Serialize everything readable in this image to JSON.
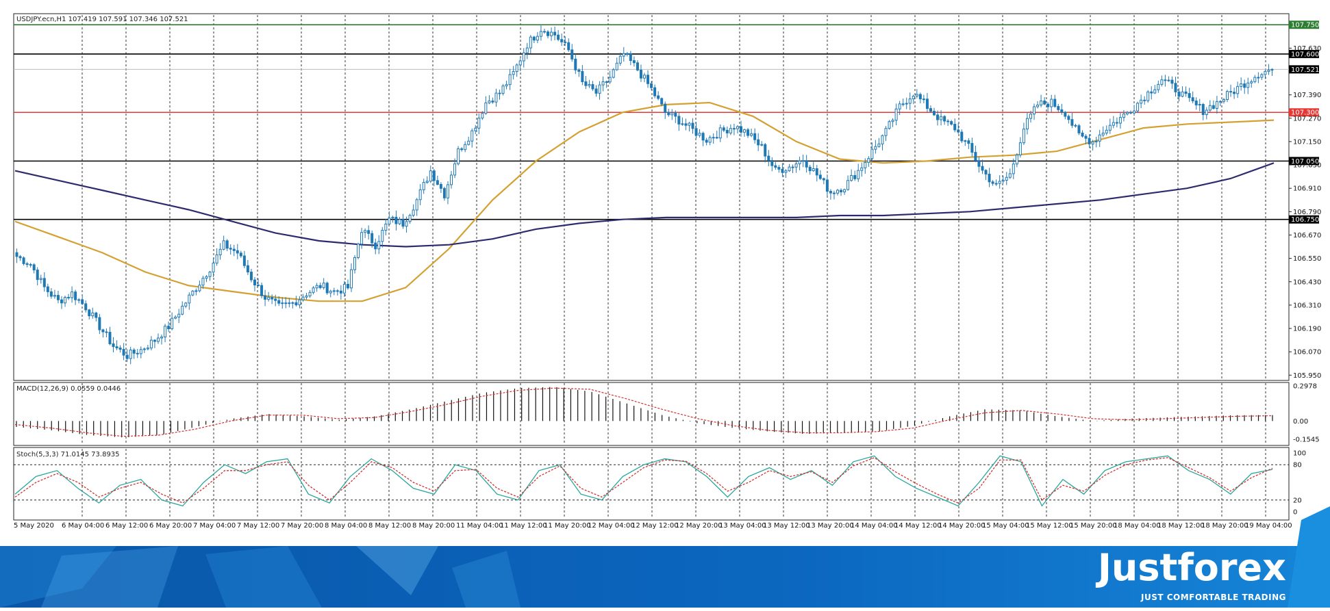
{
  "symbol_info": "USDJPY.ecn,H1  107.419 107.591 107.346 107.521",
  "brand": {
    "name": "Justforex",
    "tagline": "JUST COMFORTABLE TRADING"
  },
  "chart_data": [
    {
      "type": "candlestick",
      "pane": "price",
      "title": "USDJPY.ecn,H1  107.419 107.591 107.346 107.521",
      "symbol": "USDJPY.ecn",
      "timeframe": "H1",
      "last_ohlc": {
        "open": 107.419,
        "high": 107.591,
        "low": 107.346,
        "close": 107.521
      },
      "ylim": [
        105.93,
        107.8
      ],
      "y_ticks": [
        "107.630",
        "107.390",
        "107.270",
        "107.150",
        "107.030",
        "106.910",
        "106.790",
        "106.670",
        "106.550",
        "106.430",
        "106.310",
        "106.190",
        "106.070",
        "105.950"
      ],
      "x_ticks": [
        "5 May 2020",
        "6 May 04:00",
        "6 May 12:00",
        "6 May 20:00",
        "7 May 04:00",
        "7 May 12:00",
        "7 May 20:00",
        "8 May 04:00",
        "8 May 12:00",
        "8 May 20:00",
        "11 May 04:00",
        "11 May 12:00",
        "11 May 20:00",
        "12 May 04:00",
        "12 May 12:00",
        "12 May 20:00",
        "13 May 04:00",
        "13 May 12:00",
        "13 May 20:00",
        "14 May 04:00",
        "14 May 12:00",
        "14 May 20:00",
        "15 May 04:00",
        "15 May 12:00",
        "15 May 20:00",
        "18 May 04:00",
        "18 May 12:00",
        "18 May 20:00",
        "19 May 04:00"
      ],
      "grid": true,
      "close_path": [
        106.56,
        106.52,
        106.4,
        106.33,
        106.37,
        106.3,
        106.2,
        106.1,
        106.05,
        106.08,
        106.13,
        106.2,
        106.3,
        106.4,
        106.5,
        106.62,
        106.58,
        106.45,
        106.35,
        106.3,
        106.32,
        106.37,
        106.41,
        106.38,
        106.4,
        106.7,
        106.62,
        106.75,
        106.73,
        106.85,
        107.0,
        106.88,
        107.1,
        107.2,
        107.35,
        107.4,
        107.5,
        107.65,
        107.73,
        107.7,
        107.62,
        107.45,
        107.4,
        107.48,
        107.6,
        107.52,
        107.42,
        107.3,
        107.26,
        107.21,
        107.16,
        107.2,
        107.23,
        107.19,
        107.12,
        107.0,
        107.02,
        107.06,
        106.98,
        106.89,
        106.92,
        107.0,
        107.1,
        107.2,
        107.33,
        107.4,
        107.33,
        107.26,
        107.22,
        107.12,
        107.0,
        106.92,
        106.98,
        107.22,
        107.34,
        107.35,
        107.3,
        107.18,
        107.15,
        107.22,
        107.27,
        107.33,
        107.4,
        107.47,
        107.42,
        107.36,
        107.31,
        107.35,
        107.4,
        107.45,
        107.5,
        107.521
      ],
      "candle_spread": 0.045,
      "horizontal_levels": [
        {
          "value": 107.75,
          "color": "#2e7d32",
          "label": "107.750"
        },
        {
          "value": 107.6,
          "color": "#000000",
          "label": "107.600"
        },
        {
          "value": 107.3,
          "color": "#e53935",
          "label": "107.300"
        },
        {
          "value": 107.05,
          "color": "#000000",
          "label": "107.050"
        },
        {
          "value": 106.75,
          "color": "#000000",
          "label": "106.750"
        }
      ],
      "current_price": {
        "value": 107.521,
        "label": "107.521"
      },
      "moving_averages": [
        {
          "color": "#d4a030",
          "values": [
            106.74,
            106.66,
            106.58,
            106.48,
            106.41,
            106.38,
            106.35,
            106.33,
            106.33,
            106.4,
            106.6,
            106.85,
            107.05,
            107.2,
            107.3,
            107.34,
            107.35,
            107.28,
            107.15,
            107.06,
            107.04,
            107.05,
            107.07,
            107.08,
            107.1,
            107.16,
            107.22,
            107.24,
            107.25,
            107.26
          ]
        },
        {
          "color": "#2d2a6e",
          "values": [
            107.0,
            106.95,
            106.9,
            106.85,
            106.8,
            106.74,
            106.68,
            106.64,
            106.62,
            106.61,
            106.62,
            106.65,
            106.7,
            106.73,
            106.75,
            106.76,
            106.76,
            106.76,
            106.76,
            106.77,
            106.77,
            106.78,
            106.79,
            106.81,
            106.83,
            106.85,
            106.88,
            106.91,
            106.96,
            107.04
          ]
        }
      ],
      "colors": {
        "up": "#ffffff",
        "down": "#1f78b4",
        "border": "#1f78b4"
      }
    },
    {
      "type": "bar",
      "pane": "macd",
      "title": "MACD(12,26,9) 0.0559 0.0446",
      "ylim": [
        -0.19,
        0.31
      ],
      "y_ticks": [
        "0.2978",
        "0.00",
        "-0.1545"
      ],
      "histogram_path": [
        -0.05,
        -0.08,
        -0.12,
        -0.14,
        -0.12,
        -0.05,
        0.02,
        0.06,
        0.04,
        0.01,
        0.04,
        0.1,
        0.17,
        0.24,
        0.28,
        0.29,
        0.25,
        0.15,
        0.05,
        -0.02,
        -0.06,
        -0.09,
        -0.11,
        -0.1,
        -0.09,
        -0.04,
        0.04,
        0.1,
        0.09,
        0.04,
        0.0,
        0.02,
        0.03,
        0.04,
        0.05,
        0.05
      ],
      "signal_path": [
        -0.03,
        -0.06,
        -0.1,
        -0.13,
        -0.12,
        -0.07,
        0.0,
        0.05,
        0.05,
        0.02,
        0.03,
        0.08,
        0.14,
        0.21,
        0.26,
        0.28,
        0.27,
        0.19,
        0.1,
        0.02,
        -0.04,
        -0.08,
        -0.1,
        -0.1,
        -0.09,
        -0.06,
        0.01,
        0.07,
        0.09,
        0.06,
        0.02,
        0.01,
        0.02,
        0.03,
        0.04,
        0.045
      ],
      "colors": {
        "histogram": "#111111",
        "signal": "#d32f2f"
      }
    },
    {
      "type": "line",
      "pane": "stochastic",
      "title": "Stoch(5,3,3) 71.0145 73.8935",
      "ylim": [
        0,
        100
      ],
      "y_ticks": [
        "100",
        "80",
        "20",
        "0"
      ],
      "levels": [
        80,
        20
      ],
      "series": [
        {
          "color": "#26a69a",
          "style": "solid",
          "values": [
            30,
            60,
            70,
            40,
            15,
            45,
            55,
            20,
            10,
            50,
            80,
            65,
            85,
            90,
            30,
            15,
            60,
            90,
            70,
            40,
            30,
            80,
            70,
            30,
            20,
            70,
            80,
            30,
            20,
            60,
            80,
            90,
            85,
            60,
            25,
            60,
            75,
            55,
            70,
            45,
            85,
            95,
            60,
            40,
            25,
            10,
            50,
            95,
            85,
            10,
            55,
            30,
            70,
            85,
            90,
            95,
            70,
            55,
            30,
            65,
            72
          ]
        },
        {
          "color": "#d32f2f",
          "style": "dashed",
          "values": [
            25,
            50,
            65,
            50,
            25,
            40,
            50,
            30,
            15,
            40,
            70,
            70,
            80,
            85,
            45,
            20,
            50,
            85,
            75,
            50,
            35,
            70,
            72,
            40,
            25,
            60,
            78,
            40,
            25,
            50,
            75,
            88,
            86,
            65,
            35,
            50,
            70,
            60,
            68,
            50,
            78,
            92,
            68,
            48,
            30,
            15,
            40,
            88,
            88,
            20,
            45,
            35,
            62,
            80,
            88,
            92,
            75,
            58,
            35,
            58,
            74
          ]
        }
      ]
    }
  ]
}
